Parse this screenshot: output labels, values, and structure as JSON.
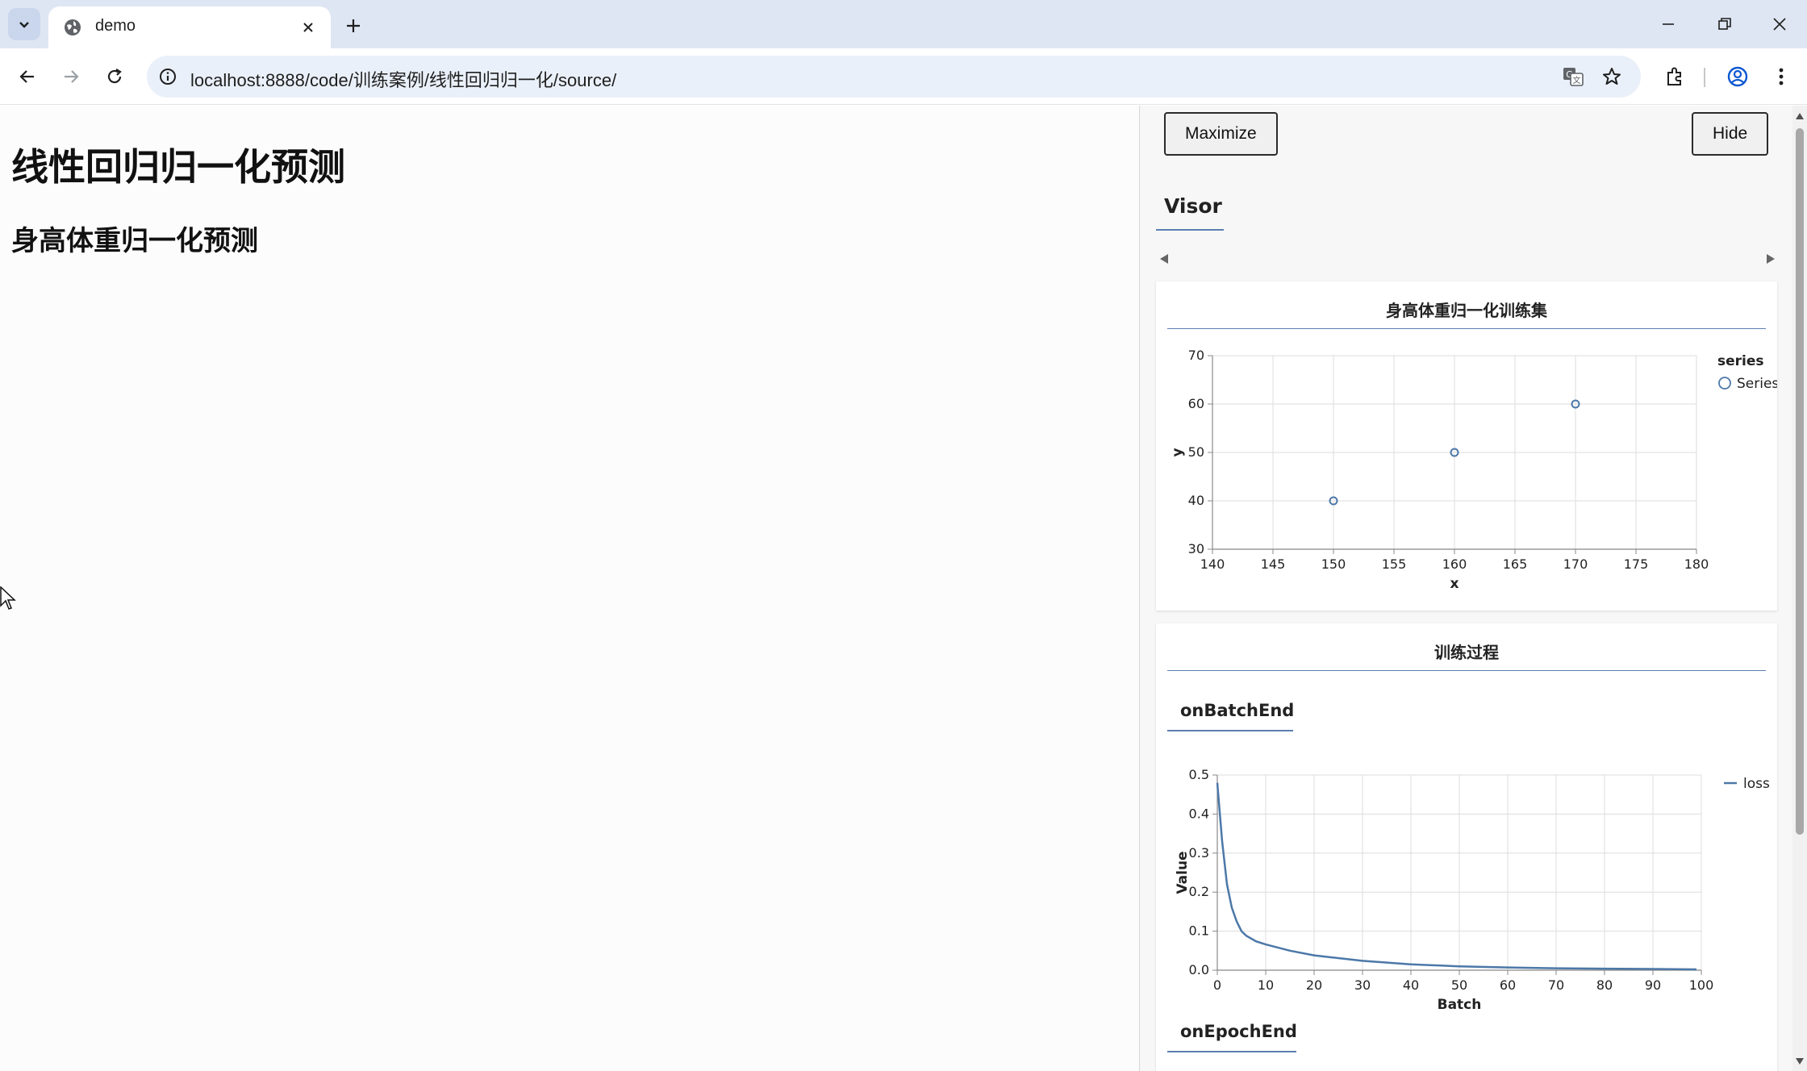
{
  "browser": {
    "tab_title": "demo",
    "url": "localhost:8888/code/训练案例/线性回归归一化/source/"
  },
  "page": {
    "h1": "线性回归归一化预测",
    "h2": "身高体重归一化预测"
  },
  "visor": {
    "maximize_label": "Maximize",
    "hide_label": "Hide",
    "tab_label": "Visor",
    "scatter_card_title": "身高体重归一化训练集",
    "training_card_title": "训练过程",
    "batch_heading": "onBatchEnd",
    "epoch_heading": "onEpochEnd"
  },
  "colors": {
    "accent": "#4c78a8",
    "grid": "#dddddd",
    "axis": "#888888"
  },
  "chart_data": [
    {
      "type": "scatter",
      "title": "身高体重归一化训练集",
      "xlabel": "x",
      "ylabel": "y",
      "xlim": [
        140,
        180
      ],
      "ylim": [
        30,
        70
      ],
      "x_ticks": [
        "140",
        "145",
        "150",
        "155",
        "160",
        "165",
        "170",
        "175",
        "180"
      ],
      "y_ticks": [
        "30",
        "40",
        "50",
        "60",
        "70"
      ],
      "legend_title": "series",
      "legend_placement": "top-right",
      "series": [
        {
          "name": "Series",
          "x": [
            150,
            160,
            170
          ],
          "y": [
            40,
            50,
            60
          ]
        }
      ]
    },
    {
      "type": "line",
      "title": "",
      "xlabel": "Batch",
      "ylabel": "Value",
      "xlim": [
        0,
        100
      ],
      "ylim": [
        0,
        0.5
      ],
      "x_ticks": [
        "0",
        "10",
        "20",
        "30",
        "40",
        "50",
        "60",
        "70",
        "80",
        "90",
        "100"
      ],
      "y_ticks": [
        "0.0",
        "0.1",
        "0.2",
        "0.3",
        "0.4",
        "0.5"
      ],
      "legend_placement": "top-right",
      "series": [
        {
          "name": "loss",
          "x": [
            0,
            1,
            2,
            3,
            4,
            5,
            6,
            8,
            10,
            15,
            20,
            30,
            40,
            50,
            60,
            70,
            80,
            90,
            99
          ],
          "y": [
            0.48,
            0.33,
            0.22,
            0.16,
            0.125,
            0.1,
            0.088,
            0.074,
            0.066,
            0.05,
            0.038,
            0.024,
            0.015,
            0.01,
            0.007,
            0.005,
            0.004,
            0.003,
            0.002
          ]
        }
      ]
    }
  ]
}
